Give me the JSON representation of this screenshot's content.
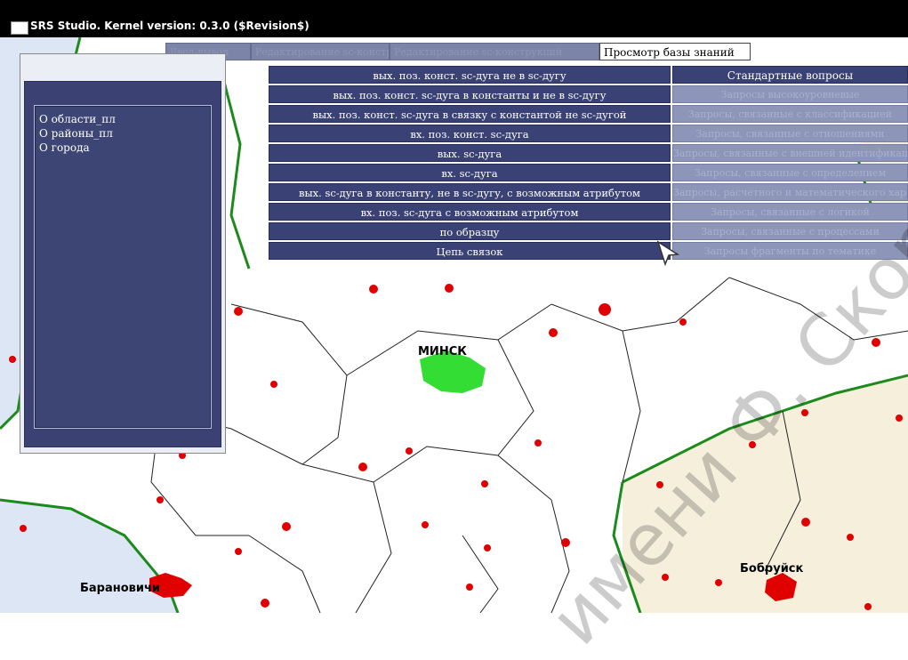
{
  "window": {
    "title": "SRS Studio. Kernel version: 0.3.0 ($Revision$)"
  },
  "tabs": [
    {
      "label": "Ввод-вывод"
    },
    {
      "label": "Редактирование sc-конструкций"
    },
    {
      "label": "Редактирование sc-конструкций"
    },
    {
      "label": "Просмотр базы знаний",
      "active": true
    }
  ],
  "panel": {
    "items": [
      {
        "label": "О  области_пл"
      },
      {
        "label": "О  районы_пл"
      },
      {
        "label": "О  города"
      }
    ]
  },
  "menu": {
    "items": [
      {
        "label": "вых. поз. конст. sc-дуга не в sc-дугу"
      },
      {
        "label": "вых. поз. конст. sc-дуга в константы и не в sc-дугу"
      },
      {
        "label": "вых. поз. конст. sc-дуга в связку с константой не sc-дугой"
      },
      {
        "label": "вх. поз. конст. sc-дуга"
      },
      {
        "label": "вых. sc-дуга"
      },
      {
        "label": "вх. sc-дуга"
      },
      {
        "label": "вых. sc-дуга в константу, не в sc-дугу, с возможным атрибутом"
      },
      {
        "label": "вх. поз. sc-дуга с возможным атрибутом"
      },
      {
        "label": "по образцу"
      },
      {
        "label": "Цепь связок"
      }
    ]
  },
  "submenu": {
    "items": [
      {
        "label": "Стандартные вопросы"
      },
      {
        "label": "Запросы высокоуровневые"
      },
      {
        "label": "Запросы, связанные с классификацией"
      },
      {
        "label": "Запросы, связанные с отношениями"
      },
      {
        "label": "Запросы, связанные с внешней идентификацией"
      },
      {
        "label": "Запросы, связанные с определением"
      },
      {
        "label": "Запросы, расчетного и математического характера"
      },
      {
        "label": "Запросы, связанные с логикой"
      },
      {
        "label": "Запросы, связанные с процессами"
      },
      {
        "label": "Запросы фрагменты по тематике"
      }
    ]
  },
  "map": {
    "labels": {
      "minsk": "МИНСК",
      "bobruisk": "Бобруйск",
      "baranovichi": "Барановичи"
    }
  },
  "watermark": {
    "text": "имени Ф. Скорины"
  },
  "colors": {
    "menu_bg": "#3a4174",
    "border_green": "#1d8a1d",
    "city_red": "#e00000",
    "minsk_green": "#33dd33",
    "region_beige": "#f5efdc",
    "water_blue": "#dce6f5"
  }
}
